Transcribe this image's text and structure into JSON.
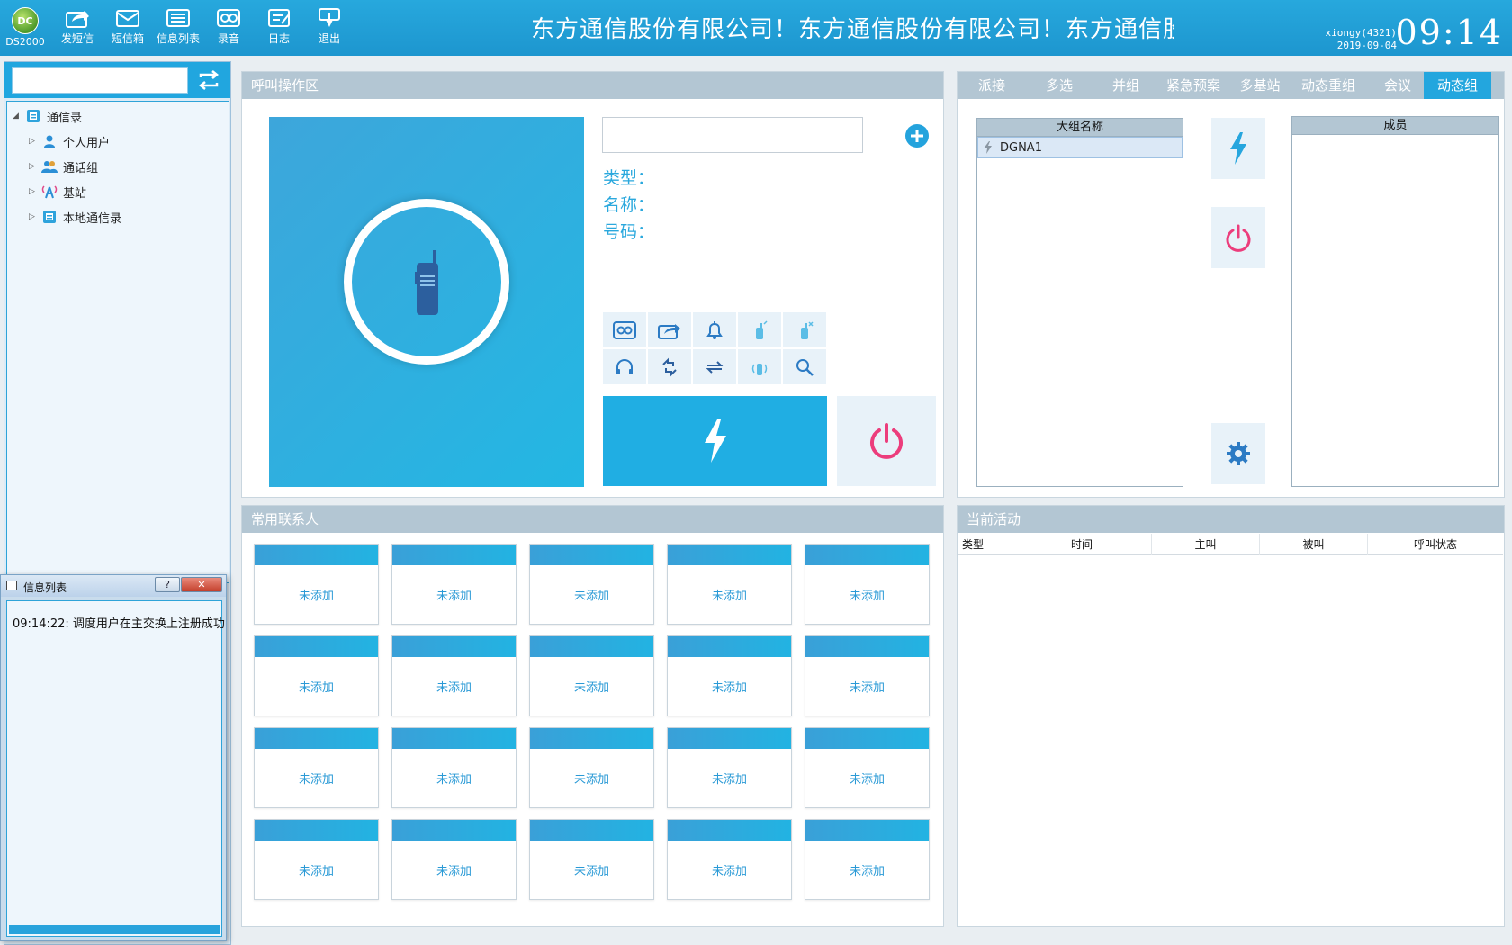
{
  "toolbar": {
    "logo_text": "DC",
    "logo_label": "DS2000",
    "buttons": [
      {
        "label": "发短信",
        "icon": "send-sms-icon"
      },
      {
        "label": "短信箱",
        "icon": "mailbox-icon"
      },
      {
        "label": "信息列表",
        "icon": "message-list-icon"
      },
      {
        "label": "录音",
        "icon": "recording-icon"
      },
      {
        "label": "日志",
        "icon": "log-icon"
      },
      {
        "label": "退出",
        "icon": "exit-icon"
      }
    ],
    "marquee": "东方通信股份有限公司！东方通信股份有限公司！东方通信股份有限公司！",
    "user": "xiongy(4321)",
    "date": "2019-09-04",
    "clock": "09:14"
  },
  "sidebar": {
    "search_value": "",
    "tree": {
      "root": "通信录",
      "children": [
        "个人用户",
        "通话组",
        "基站",
        "本地通信录"
      ]
    }
  },
  "msg_window": {
    "title": "信息列表",
    "help": "?",
    "close": "✕",
    "messages": [
      "09:14:22: 调度用户在主交换上注册成功"
    ]
  },
  "call_panel": {
    "title": "呼叫操作区",
    "number_value": "",
    "type_label": "类型：",
    "name_label": "名称：",
    "number_label": "号码："
  },
  "right_panel": {
    "tabs": [
      "派接",
      "多选",
      "并组",
      "紧急预案",
      "多基站",
      "动态重组",
      "会议",
      "动态组"
    ],
    "active_tab": "动态组",
    "group_list_header": "大组名称",
    "group_items": [
      "DGNA1"
    ],
    "member_header": "成员"
  },
  "contacts_panel": {
    "title": "常用联系人",
    "cells": [
      "未添加",
      "未添加",
      "未添加",
      "未添加",
      "未添加",
      "未添加",
      "未添加",
      "未添加",
      "未添加",
      "未添加",
      "未添加",
      "未添加",
      "未添加",
      "未添加",
      "未添加",
      "未添加",
      "未添加",
      "未添加",
      "未添加",
      "未添加"
    ]
  },
  "activity_panel": {
    "title": "当前活动",
    "columns": [
      "类型",
      "时间",
      "主叫",
      "被叫",
      "呼叫状态"
    ]
  },
  "colors": {
    "accent": "#23a6de",
    "hangup": "#ec3d7c",
    "panel_header": "#b3c6d3"
  }
}
